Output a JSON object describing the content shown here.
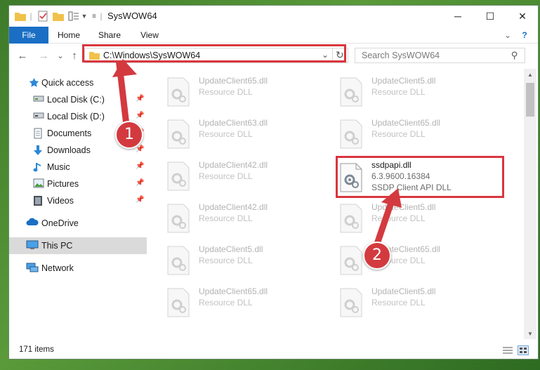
{
  "window": {
    "title": "SysWOW64",
    "controls": {
      "minimize": "─",
      "maximize": "☐",
      "close": "✕"
    }
  },
  "ribbon": {
    "tabs": [
      "File",
      "Home",
      "Share",
      "View"
    ],
    "expand_glyph": "⌄",
    "help_glyph": "?"
  },
  "address_bar": {
    "path": "C:\\Windows\\SysWOW64",
    "dropdown_glyph": "⌄",
    "refresh_glyph": "↻"
  },
  "nav": {
    "back": "←",
    "forward": "→",
    "recent": "⌄",
    "up": "↑"
  },
  "search": {
    "placeholder": "Search SysWOW64",
    "icon_glyph": "⚲"
  },
  "sidebar": {
    "items": [
      {
        "label": "Quick access",
        "icon": "star-icon",
        "pinned": false
      },
      {
        "label": "Local Disk (C:)",
        "icon": "drive-icon",
        "pinned": true
      },
      {
        "label": "Local Disk (D:)",
        "icon": "drive-icon",
        "pinned": true
      },
      {
        "label": "Documents",
        "icon": "documents-icon",
        "pinned": true
      },
      {
        "label": "Downloads",
        "icon": "download-icon",
        "pinned": true
      },
      {
        "label": "Music",
        "icon": "music-icon",
        "pinned": true
      },
      {
        "label": "Pictures",
        "icon": "pictures-icon",
        "pinned": true
      },
      {
        "label": "Videos",
        "icon": "videos-icon",
        "pinned": true
      },
      {
        "label": "OneDrive",
        "icon": "cloud-icon",
        "pinned": false
      },
      {
        "label": "This PC",
        "icon": "computer-icon",
        "pinned": false,
        "selected": true
      },
      {
        "label": "Network",
        "icon": "network-icon",
        "pinned": false
      }
    ],
    "pin_glyph": "📌"
  },
  "files": {
    "left_column": [
      {
        "name": "UpdateClient65.dll",
        "type": "Resource DLL"
      },
      {
        "name": "UpdateClient63.dll",
        "type": "Resource DLL"
      },
      {
        "name": "UpdateClient42.dll",
        "type": "Resource DLL"
      },
      {
        "name": "UpdateClient42.dll",
        "type": "Resource DLL"
      },
      {
        "name": "UpdateClient5.dll",
        "type": "Resource DLL"
      },
      {
        "name": "UpdateClient65.dll",
        "type": "Resource DLL"
      }
    ],
    "right_column": [
      {
        "name": "UpdateClient5.dll",
        "type": "Resource DLL"
      },
      {
        "name": "UpdateClient65.dll",
        "type": "Resource DLL"
      },
      {
        "name": "ssdpapi.dll",
        "version": "6.3.9600.16384",
        "type": "SSDP Client API DLL",
        "highlighted": true
      },
      {
        "name": "UpdateClient5.dll",
        "type": "Resource DLL"
      },
      {
        "name": "UpdateClient65.dll",
        "type": "Resource DLL"
      },
      {
        "name": "UpdateClient5.dll",
        "type": "Resource DLL"
      }
    ]
  },
  "status": {
    "item_count": "171 items"
  },
  "annotations": {
    "step1": "1",
    "step2": "2",
    "color": "#d33a3f"
  }
}
